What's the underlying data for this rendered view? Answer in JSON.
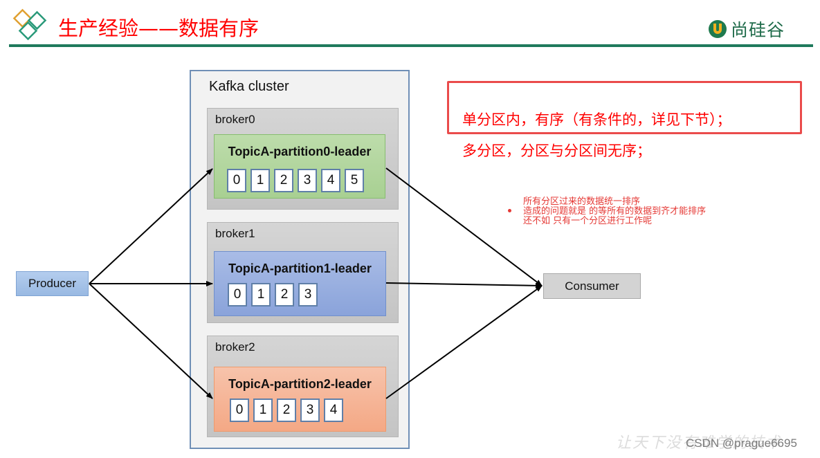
{
  "header": {
    "title": "生产经验——数据有序",
    "brand": "尚硅谷",
    "colors": {
      "title": "#ff0000",
      "rule": "#1f7a5c",
      "brand": "#1f6b4a"
    }
  },
  "diagram": {
    "producer": "Producer",
    "consumer": "Consumer",
    "cluster_label": "Kafka cluster",
    "brokers": [
      {
        "name": "broker0",
        "partition": "TopicA-partition0-leader",
        "messages": [
          "0",
          "1",
          "2",
          "3",
          "4",
          "5"
        ],
        "color": "#b5d8a3"
      },
      {
        "name": "broker1",
        "partition": "TopicA-partition1-leader",
        "messages": [
          "0",
          "1",
          "2",
          "3"
        ],
        "color": "#97aede"
      },
      {
        "name": "broker2",
        "partition": "TopicA-partition2-leader",
        "messages": [
          "0",
          "1",
          "2",
          "3",
          "4"
        ],
        "color": "#f6b397"
      }
    ]
  },
  "notes": {
    "line1": "单分区内，有序（有条件的，详见下节）；",
    "line2": "多分区，分区与分区间无序；",
    "comment": [
      "所有分区过来的数据统一排序",
      "造成的问题就是  的等所有的数据到齐才能排序",
      "还不如  只有一个分区进行工作呢"
    ]
  },
  "watermark": {
    "slogan": "让天下没有难学的技术",
    "credit": "CSDN @prague6695"
  }
}
